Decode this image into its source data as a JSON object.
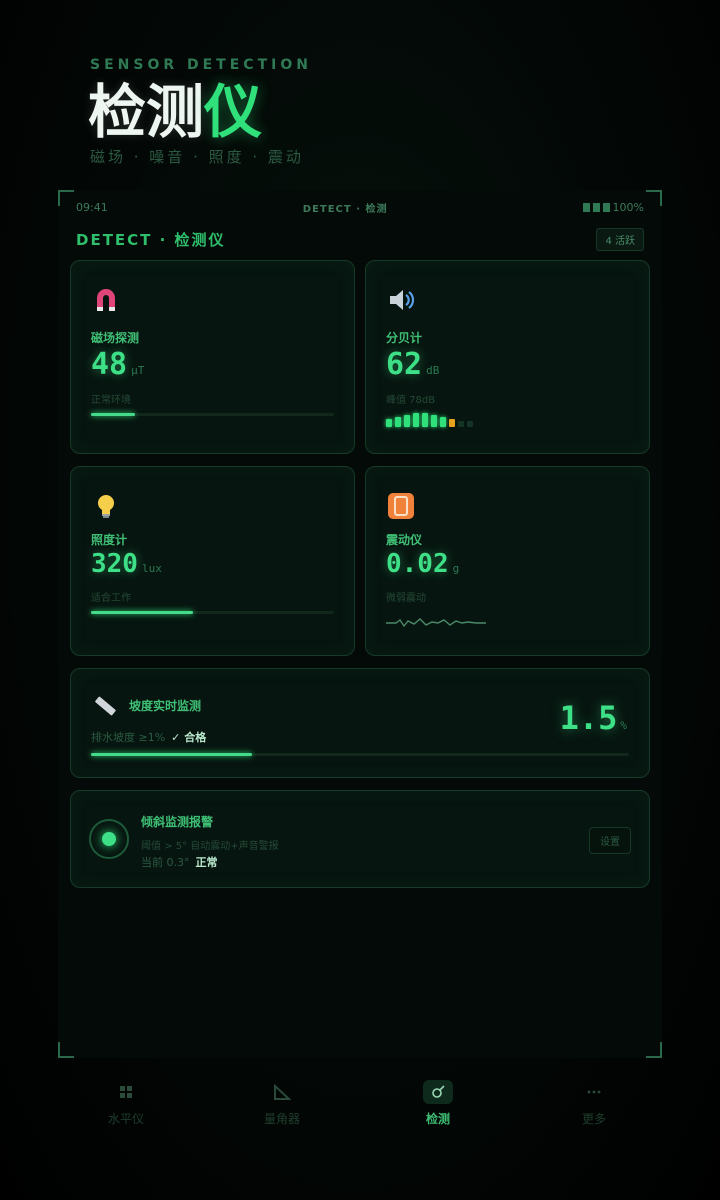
{
  "header": {
    "eyebrow": "SENSOR DETECTION",
    "title_main": "检测",
    "title_accent": "仪",
    "tagline": "磁场 · 噪音 · 照度 · 震动"
  },
  "status_bar": {
    "time": "09:41",
    "center": "DETECT · 检测",
    "battery": "100%"
  },
  "app_header": {
    "title": "DETECT · 检测仪",
    "badge": "4 活跃"
  },
  "cards": {
    "magnetic": {
      "icon": "magnet-icon",
      "label": "磁场探测",
      "value": "48",
      "unit": "μT",
      "sub": "正常环境",
      "level": 0.18
    },
    "decibel": {
      "icon": "speaker-icon",
      "label": "分贝计",
      "value": "62",
      "unit": "dB",
      "sub": "峰值 78dB",
      "segments_on": 7,
      "segments_warn": 1,
      "segments_total": 10
    },
    "illuminance": {
      "icon": "lightbulb-icon",
      "label": "照度计",
      "value": "320",
      "unit": "lux",
      "sub": "适合工作",
      "level": 0.42
    },
    "vibration": {
      "icon": "vibration-icon",
      "label": "震动仪",
      "value": "0.02",
      "unit": "g",
      "sub": "微弱震动"
    }
  },
  "slope": {
    "icon": "ruler-icon",
    "label": "坡度实时监测",
    "value": "1.5",
    "unit": "%",
    "standard": "排水坡度 ≥1%",
    "status": "✓ 合格",
    "level": 0.3
  },
  "alarm": {
    "icon": "alarm-indicator-icon",
    "title": "倾斜监测报警",
    "desc": "阈值 > 5° 自动震动+声音警报",
    "current": "当前 0.3°",
    "status": "正常",
    "button": "设置"
  },
  "nav": [
    {
      "icon": "level-grid-icon",
      "label": "水平仪",
      "active": false
    },
    {
      "icon": "protractor-icon",
      "label": "量角器",
      "active": false
    },
    {
      "icon": "detector-icon",
      "label": "检测",
      "active": true
    },
    {
      "icon": "more-icon",
      "label": "更多",
      "active": false
    }
  ],
  "colors": {
    "accent": "#2fe07b",
    "warn": "#e5a21c",
    "background": "#030806"
  }
}
